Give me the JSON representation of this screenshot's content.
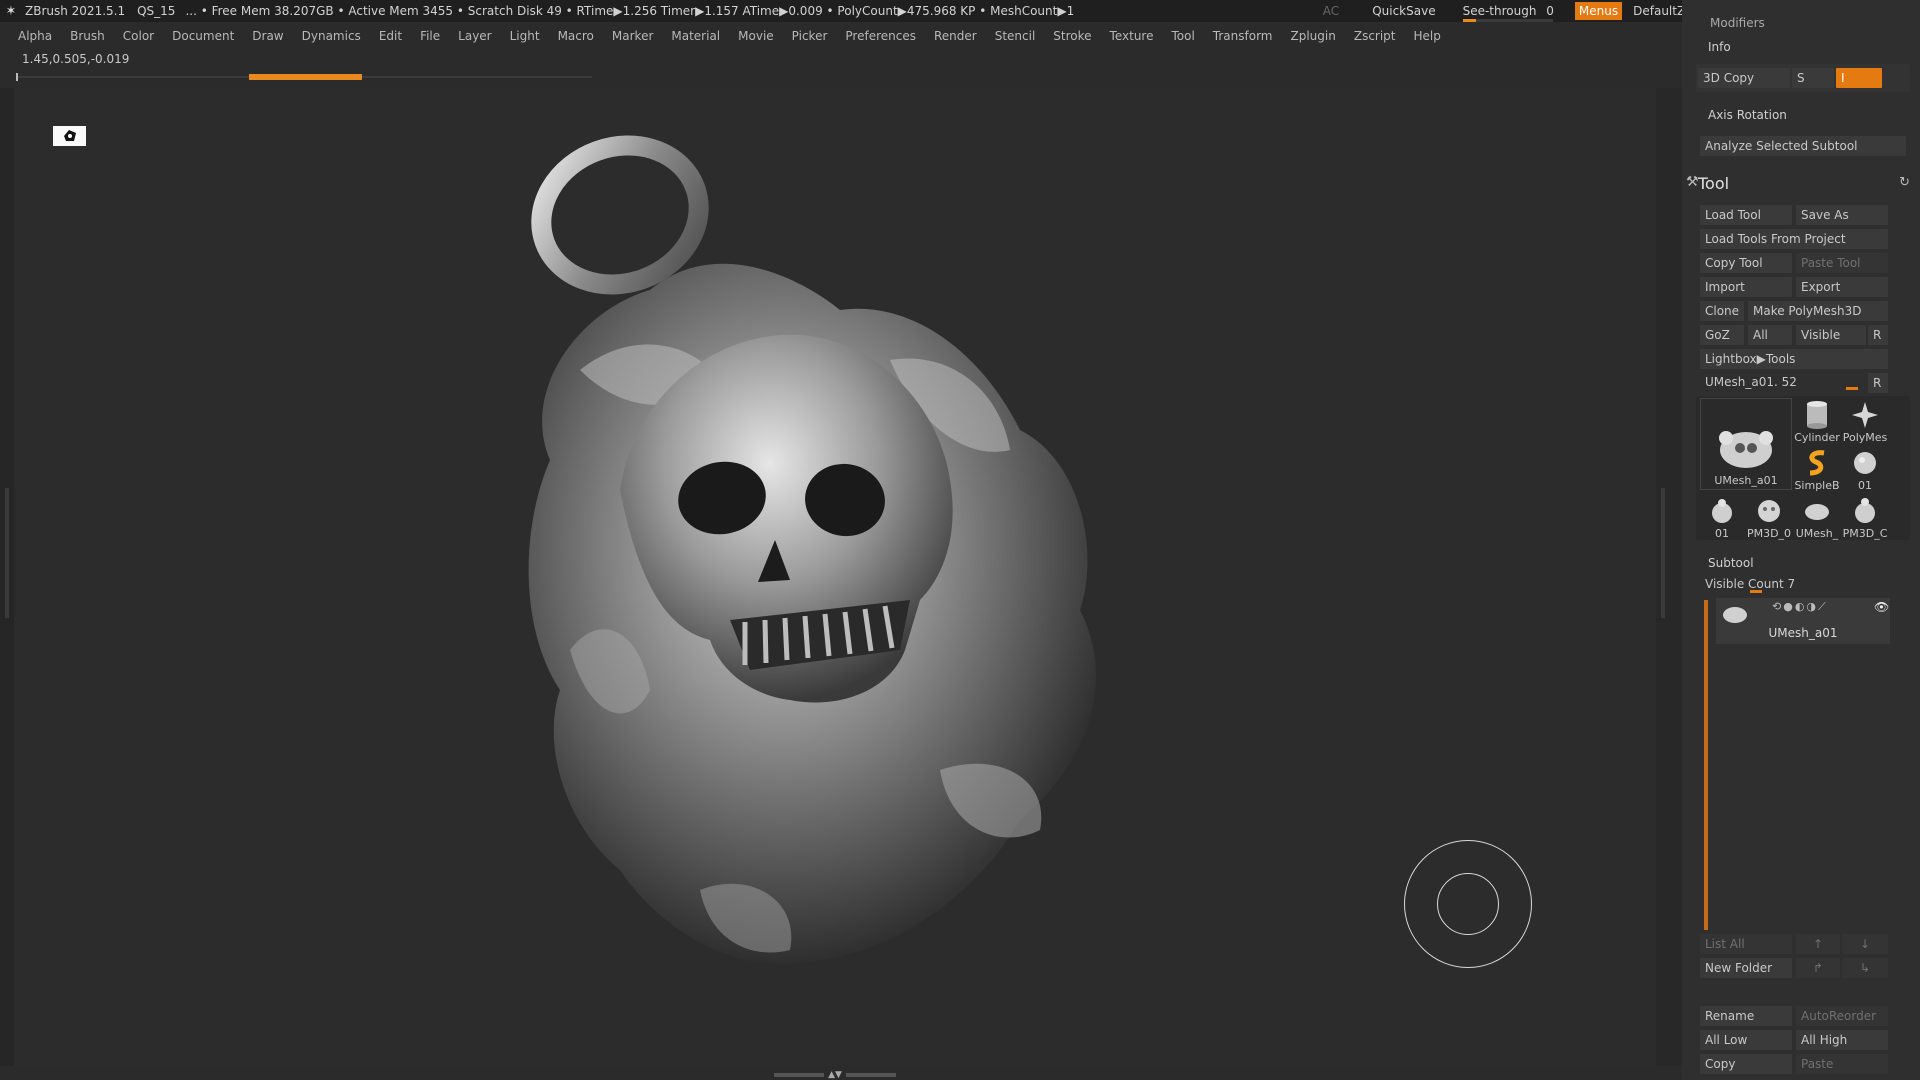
{
  "titlebar": {
    "app": "ZBrush 2021.5.1",
    "doc": "QS_15",
    "stats": "... • Free Mem 38.207GB • Active Mem 3455 • Scratch Disk 49 • RTime▶1.256 Timer▶1.157 ATime▶0.009 • PolyCount▶475.968 KP • MeshCount▶1",
    "ac": "AC",
    "quicksave": "QuickSave",
    "see_through_label": "See-through",
    "see_through_value": "0",
    "menus": "Menus",
    "script": "DefaultZScript",
    "see_through_level": 0.15
  },
  "menubar": {
    "items": [
      "Alpha",
      "Brush",
      "Color",
      "Document",
      "Draw",
      "Dynamics",
      "Edit",
      "File",
      "Layer",
      "Light",
      "Macro",
      "Marker",
      "Material",
      "Movie",
      "Picker",
      "Preferences",
      "Render",
      "Stencil",
      "Stroke",
      "Texture",
      "Tool",
      "Transform",
      "Zplugin",
      "Zscript",
      "Help"
    ]
  },
  "coords": "1.45,0.505,-0.019",
  "progress": {
    "start_fraction": 0.405,
    "end_fraction": 0.6,
    "color": "#e98a1f"
  },
  "panel": {
    "modifiers": "Modifiers",
    "info": "Info",
    "copy3d": "3D Copy",
    "s_label": "S",
    "i_label": "I",
    "axis_rotation": "Axis Rotation",
    "analyze": "Analyze Selected Subtool",
    "tool_title": "Tool",
    "load_tool": "Load Tool",
    "save_as": "Save As",
    "load_tools_project": "Load Tools From Project",
    "copy_tool": "Copy Tool",
    "paste_tool": "Paste Tool",
    "import": "Import",
    "export": "Export",
    "clone": "Clone",
    "make_polymesh": "Make PolyMesh3D",
    "goz": "GoZ",
    "all": "All",
    "visible": "Visible",
    "r": "R",
    "lightbox_tools": "Lightbox▶Tools",
    "current_tool": "UMesh_a01. 52",
    "subtool_title": "Subtool",
    "visible_count": "Visible Count 7",
    "subtool_name": "UMesh_a01",
    "list_all": "List All",
    "new_folder": "New Folder",
    "rename": "Rename",
    "auto_reorder": "AutoReorder",
    "all_low": "All Low",
    "all_high": "All High",
    "copy": "Copy",
    "paste": "Paste",
    "accent": "#e57a10"
  },
  "tool_thumbs": [
    {
      "label": "UMesh_a01",
      "icon": "skull-mesh-icon"
    },
    {
      "label": "Cylinder",
      "icon": "cylinder-icon"
    },
    {
      "label": "PolyMes",
      "icon": "star-icon"
    },
    {
      "label": "SimpleB",
      "icon": "simple-brush-icon"
    },
    {
      "label": "01",
      "icon": "sphere-mesh-icon"
    },
    {
      "label": "01",
      "icon": "mesh-icon"
    },
    {
      "label": "PM3D_0",
      "icon": "mesh-icon"
    },
    {
      "label": "UMesh_",
      "icon": "mesh-icon"
    },
    {
      "label": "PM3D_C",
      "icon": "mesh-icon"
    }
  ]
}
